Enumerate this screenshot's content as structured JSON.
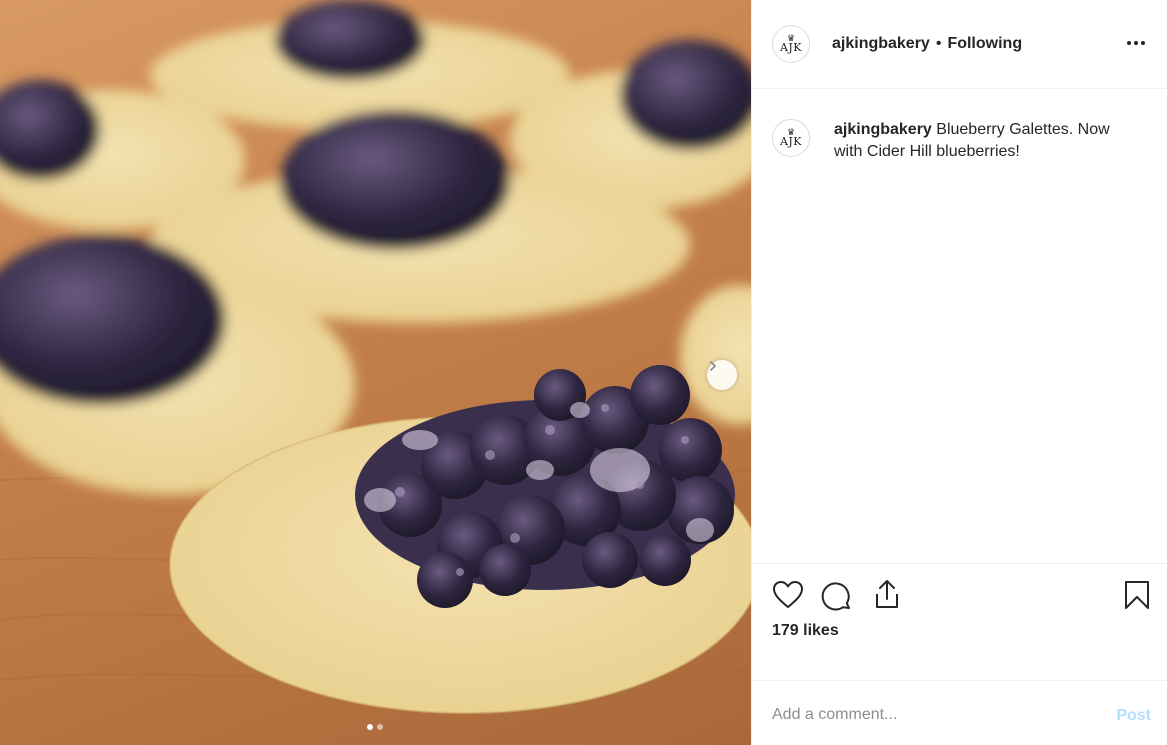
{
  "media": {
    "photo_description": "blueberry-galettes-on-dough-circles",
    "carousel": {
      "slide_count": 2,
      "active_index": 0
    },
    "next_icon": "chevron-right-icon"
  },
  "header": {
    "avatar_text": "AJK",
    "avatar_icon": "crown-icon",
    "username": "ajkingbakery",
    "separator": "•",
    "follow_status": "Following",
    "more_icon": "more-horizontal-icon"
  },
  "caption": {
    "avatar_text": "AJK",
    "username": "ajkingbakery",
    "text": "Blueberry Galettes. Now with Cider Hill blueberries!"
  },
  "actions": {
    "like_icon": "heart-icon",
    "comment_icon": "comment-icon",
    "share_icon": "share-icon",
    "save_icon": "bookmark-icon",
    "likes_text": "179 likes"
  },
  "comment": {
    "placeholder": "Add a comment...",
    "value": "",
    "post_label": "Post"
  },
  "colors": {
    "text": "#262626",
    "muted": "#8e8e8e",
    "post_disabled": "#b2dffc",
    "border": "#efefef"
  }
}
